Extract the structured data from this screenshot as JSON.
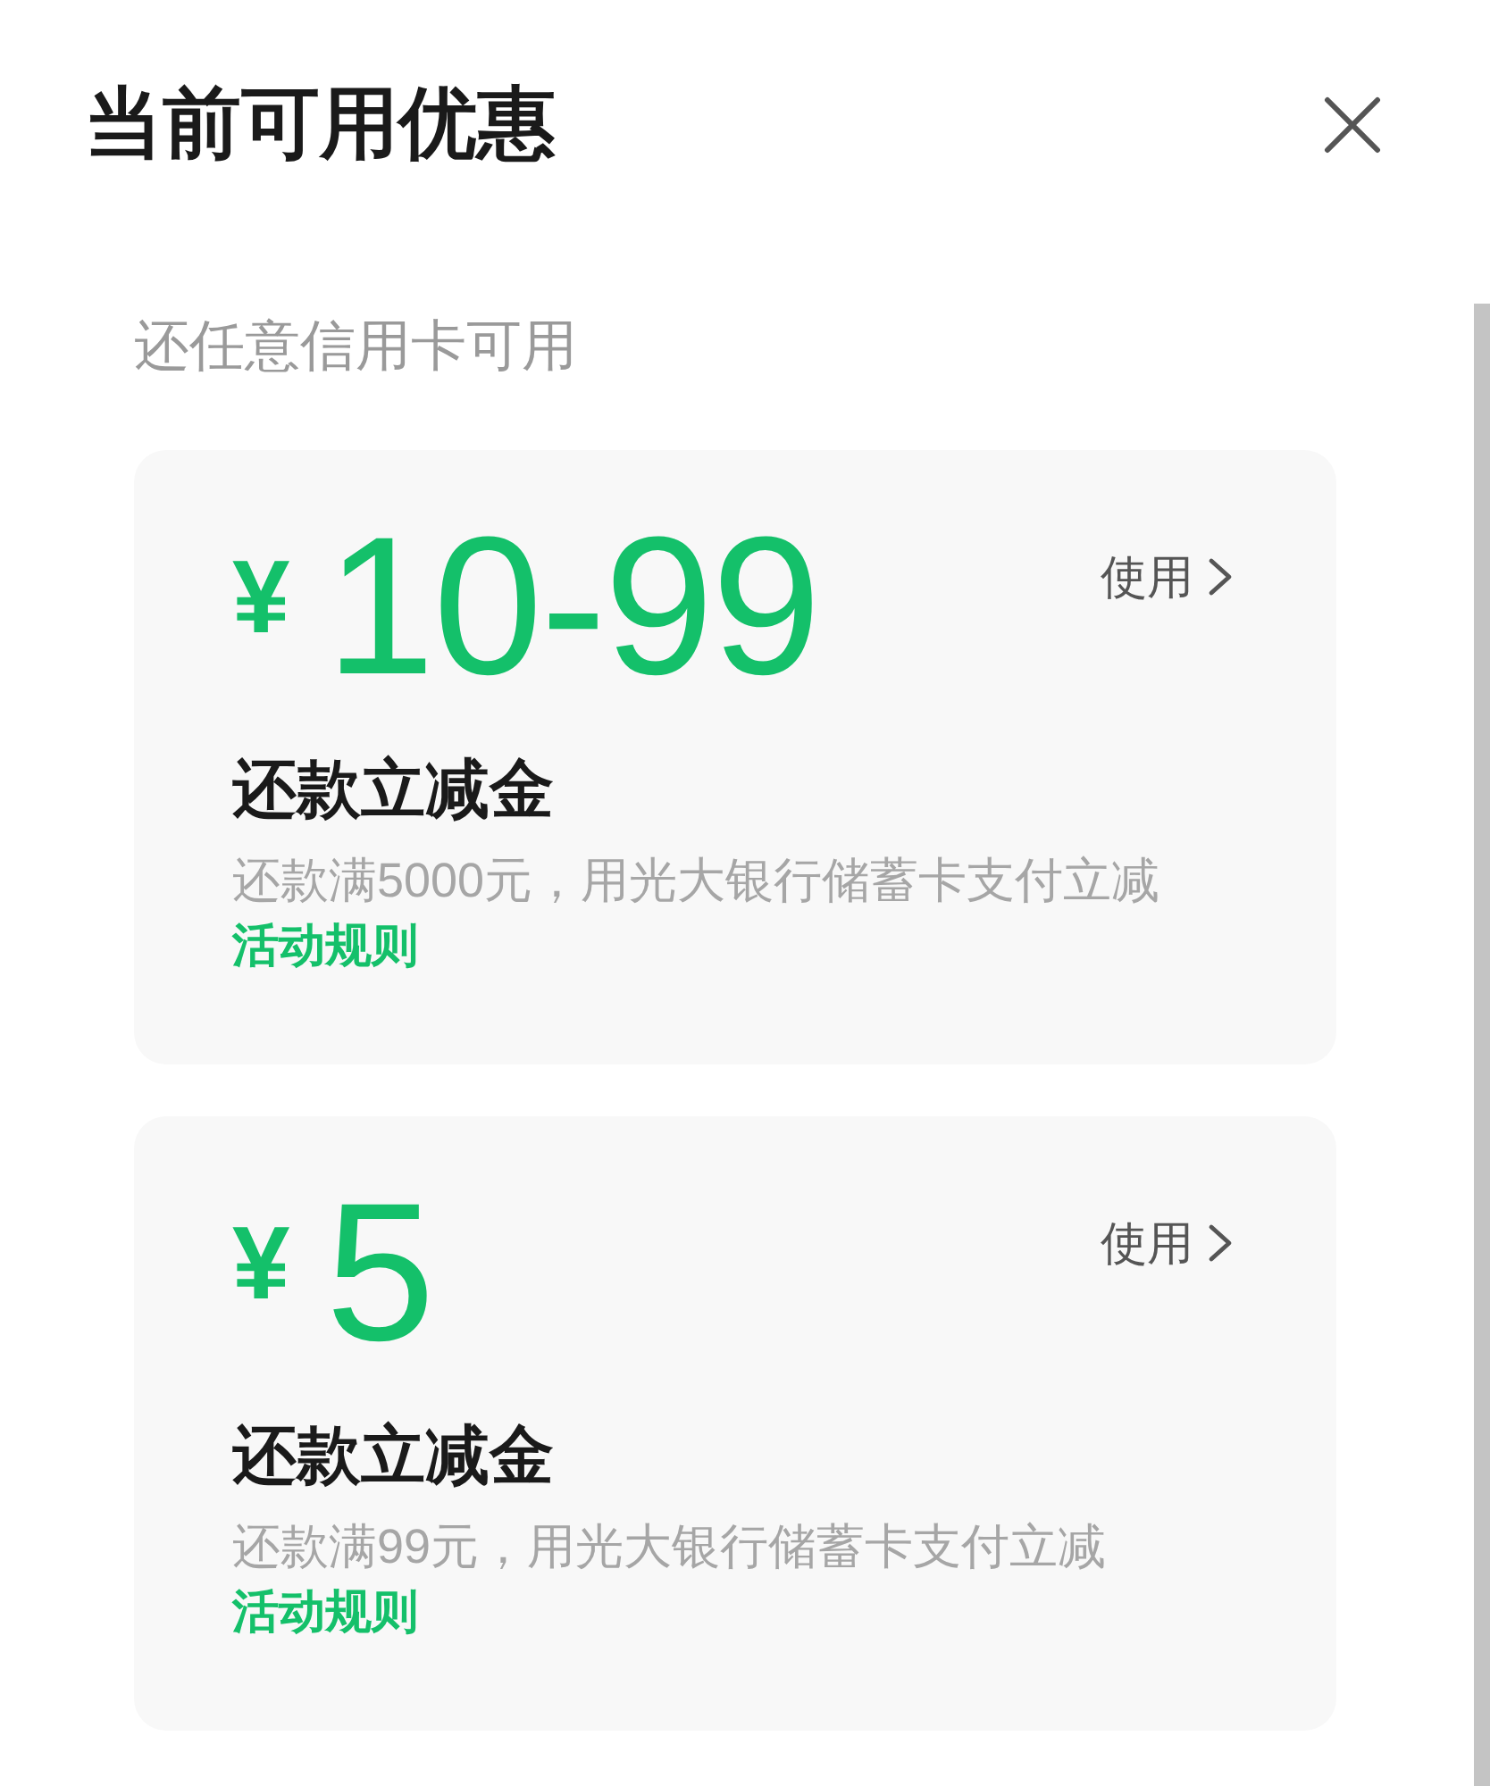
{
  "header": {
    "title": "当前可用优惠"
  },
  "section": {
    "label": "还任意信用卡可用"
  },
  "coupons": [
    {
      "currency": "¥",
      "amount": "10-99",
      "action": "使用",
      "title": "还款立减金",
      "description": "还款满5000元，用光大银行储蓄卡支付立减",
      "rules_link": "活动规则"
    },
    {
      "currency": "¥",
      "amount": "5",
      "action": "使用",
      "title": "还款立减金",
      "description": "还款满99元，用光大银行储蓄卡支付立减",
      "rules_link": "活动规则"
    }
  ]
}
